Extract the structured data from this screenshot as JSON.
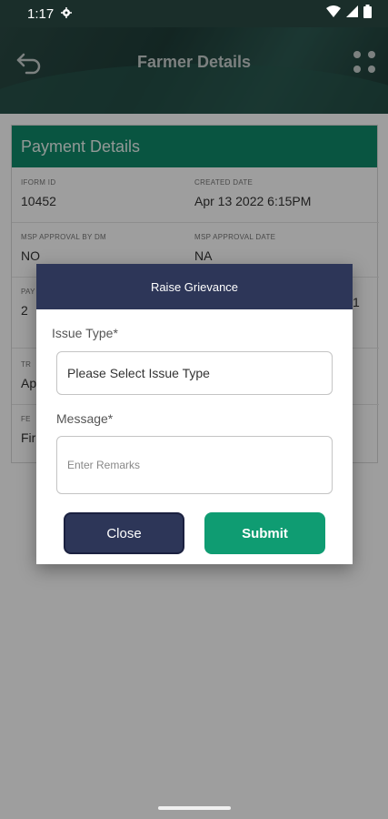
{
  "status_bar": {
    "time": "1:17"
  },
  "header": {
    "title": "Farmer Details"
  },
  "card": {
    "title": "Payment Details",
    "fields": [
      {
        "label": "IFORM ID",
        "value": "10452"
      },
      {
        "label": "CREATED DATE",
        "value": "Apr 13 2022  6:15PM"
      },
      {
        "label": "MSP APPROVAL BY DM",
        "value": "NO"
      },
      {
        "label": "MSP APPROVAL DATE",
        "value": "NA"
      },
      {
        "label": "PAY",
        "value": "2"
      },
      {
        "label": "",
        "value": "1"
      },
      {
        "label": "TR",
        "value": "Ap"
      },
      {
        "label": "FE",
        "value": "Fir"
      }
    ]
  },
  "dialog": {
    "title": "Raise Grievance",
    "issue_type_label": "Issue Type*",
    "issue_type_value": "Please Select Issue Type",
    "message_label": "Message*",
    "message_placeholder": "Enter Remarks",
    "close_label": "Close",
    "submit_label": "Submit"
  },
  "colors": {
    "accent_green": "#0f8a6a",
    "dialog_navy": "#2d3658",
    "submit_green": "#0f9c72"
  }
}
